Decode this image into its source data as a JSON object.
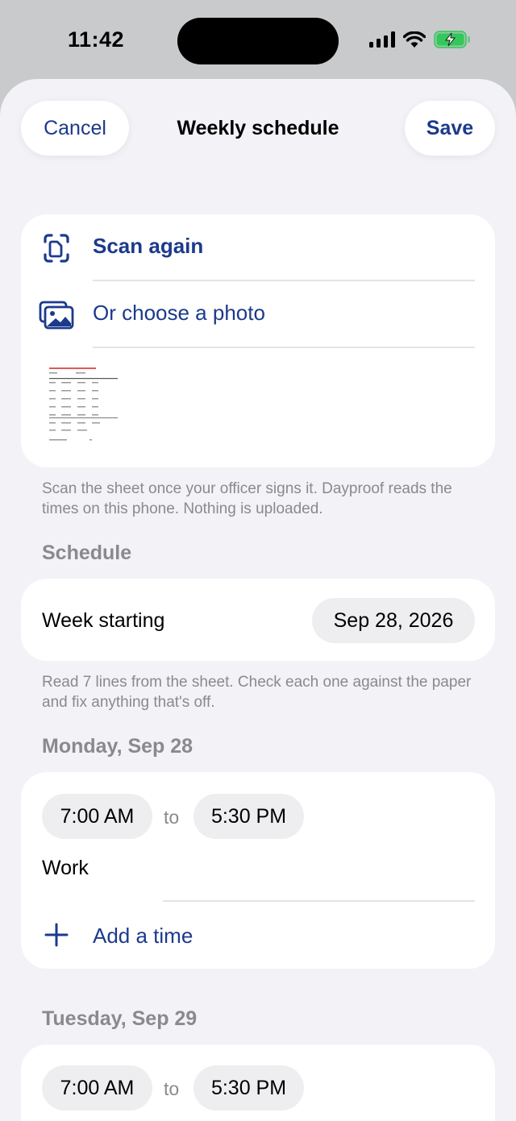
{
  "status_bar": {
    "time": "11:42"
  },
  "nav": {
    "cancel_label": "Cancel",
    "title": "Weekly schedule",
    "save_label": "Save"
  },
  "scan": {
    "scan_again_label": "Scan again",
    "choose_photo_label": "Or choose a photo",
    "footnote": "Scan the sheet once your officer signs it. Dayproof reads the times on this phone. Nothing is uploaded."
  },
  "schedule": {
    "header": "Schedule",
    "week_label": "Week starting",
    "week_value": "Sep 28, 2026",
    "footnote": "Read 7 lines from the sheet. Check each one against the paper and fix anything that's off."
  },
  "days": [
    {
      "title": "Monday, Sep 28",
      "start": "7:00 AM",
      "to": "to",
      "end": "5:30 PM",
      "activity": "Work",
      "add_label": "Add a time"
    },
    {
      "title": "Tuesday, Sep 29",
      "start": "7:00 AM",
      "to": "to",
      "end": "5:30 PM"
    }
  ],
  "colors": {
    "accent": "#1c3a8c",
    "background": "#f2f2f7",
    "secondary_text": "#8a8a8e",
    "battery_green": "#34c759"
  },
  "icons": [
    "signal-icon",
    "wifi-icon",
    "battery-charging-icon",
    "scan-document-icon",
    "photo-gallery-icon",
    "plus-icon"
  ]
}
